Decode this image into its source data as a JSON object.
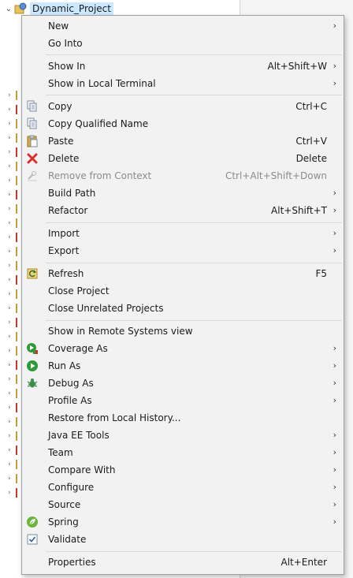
{
  "explorer": {
    "project_name": "Dynamic_Project"
  },
  "menu": {
    "new": {
      "label": "New"
    },
    "go_into": {
      "label": "Go Into"
    },
    "show_in": {
      "label": "Show In",
      "shortcut": "Alt+Shift+W"
    },
    "show_in_local_terminal": {
      "label": "Show in Local Terminal"
    },
    "copy": {
      "label": "Copy",
      "shortcut": "Ctrl+C",
      "icon": "copy-icon"
    },
    "copy_qualified_name": {
      "label": "Copy Qualified Name",
      "icon": "copy-qualified-icon"
    },
    "paste": {
      "label": "Paste",
      "shortcut": "Ctrl+V",
      "icon": "paste-icon"
    },
    "delete": {
      "label": "Delete",
      "shortcut": "Delete",
      "icon": "delete-icon"
    },
    "remove_from_context": {
      "label": "Remove from Context",
      "shortcut": "Ctrl+Alt+Shift+Down",
      "disabled": true,
      "icon": "remove-context-icon"
    },
    "build_path": {
      "label": "Build Path"
    },
    "refactor": {
      "label": "Refactor",
      "shortcut": "Alt+Shift+T"
    },
    "import": {
      "label": "Import"
    },
    "export": {
      "label": "Export"
    },
    "refresh": {
      "label": "Refresh",
      "shortcut": "F5",
      "icon": "refresh-icon"
    },
    "close_project": {
      "label": "Close Project"
    },
    "close_unrelated_projects": {
      "label": "Close Unrelated Projects"
    },
    "show_in_remote_systems": {
      "label": "Show in Remote Systems view"
    },
    "coverage_as": {
      "label": "Coverage As",
      "icon": "coverage-icon"
    },
    "run_as": {
      "label": "Run As",
      "icon": "run-icon"
    },
    "debug_as": {
      "label": "Debug As",
      "icon": "debug-icon"
    },
    "profile_as": {
      "label": "Profile As"
    },
    "restore_local_history": {
      "label": "Restore from Local History..."
    },
    "java_ee_tools": {
      "label": "Java EE Tools"
    },
    "team": {
      "label": "Team"
    },
    "compare_with": {
      "label": "Compare With"
    },
    "configure": {
      "label": "Configure"
    },
    "source": {
      "label": "Source"
    },
    "spring": {
      "label": "Spring",
      "icon": "spring-icon"
    },
    "validate": {
      "label": "Validate",
      "icon": "validate-checkbox-icon",
      "checked": true
    },
    "properties": {
      "label": "Properties",
      "shortcut": "Alt+Enter"
    }
  },
  "colors": {
    "menu_background": "#f2f2f2",
    "selection_highlight": "#cce8ff",
    "disabled_text": "#8c8c8c",
    "delete_red": "#d9302c",
    "run_green": "#2e9b3a",
    "spring_green": "#6db33f"
  }
}
